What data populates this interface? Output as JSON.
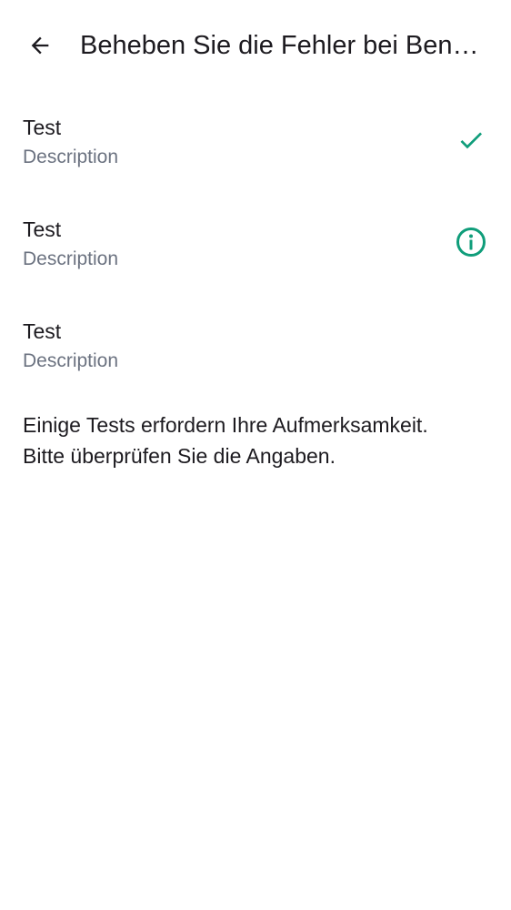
{
  "header": {
    "back_icon": "arrow-back-icon",
    "title": "Beheben Sie die Fehler bei Ben…"
  },
  "tests": [
    {
      "title": "Test",
      "description": "Description",
      "status": "passed",
      "status_icon": "check-icon"
    },
    {
      "title": "Test",
      "description": "Description",
      "status": "attention",
      "status_icon": "info-icon"
    },
    {
      "title": "Test",
      "description": "Description",
      "status": "none",
      "status_icon": ""
    }
  ],
  "message": {
    "line1": "Einige Tests erfordern Ihre Aufmerksamkeit.",
    "line2": "Bitte überprüfen Sie die Angaben."
  },
  "colors": {
    "accent": "#0f9d7a",
    "text": "#1d1b20",
    "secondary_text": "#6b7280",
    "background": "#ffffff"
  }
}
